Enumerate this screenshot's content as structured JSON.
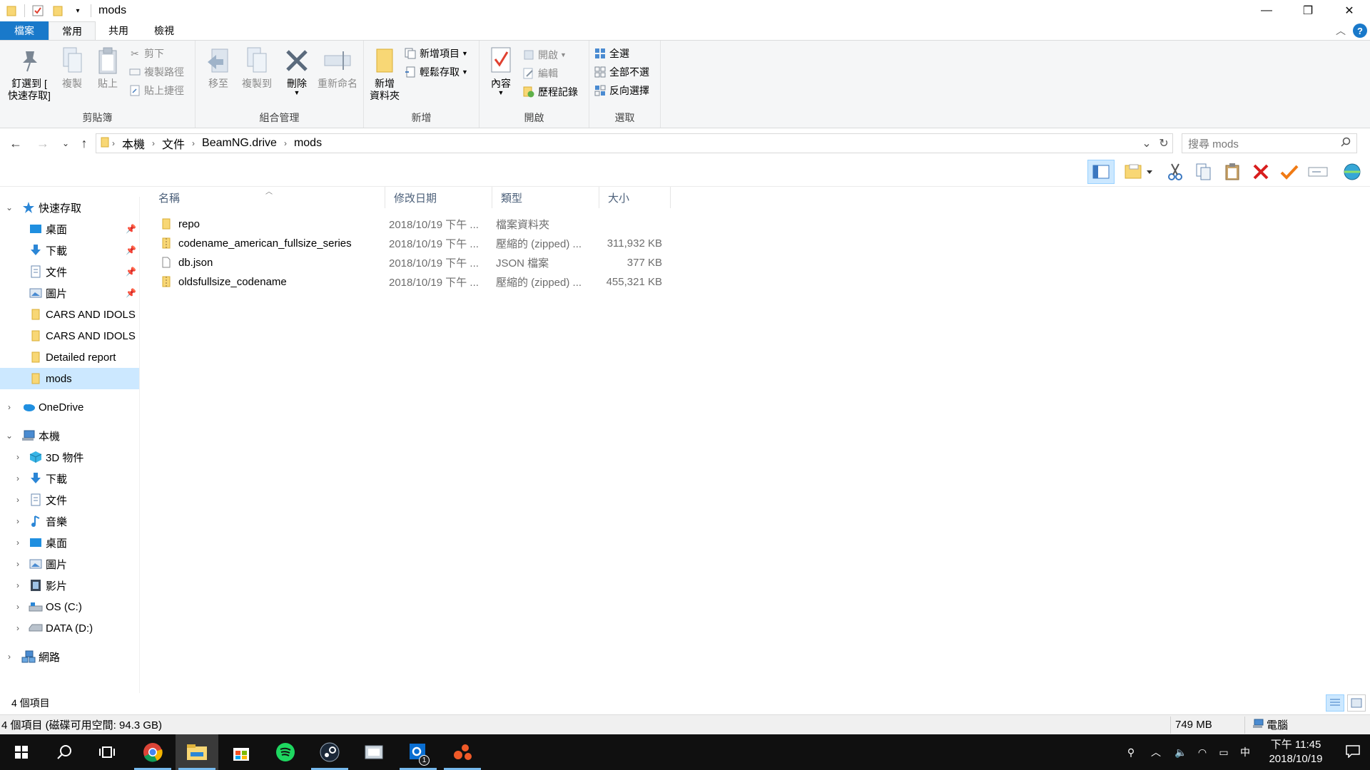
{
  "window": {
    "title": "mods",
    "minimize": "—",
    "restore": "❐",
    "close": "✕"
  },
  "tabs": {
    "file": "檔案",
    "home": "常用",
    "share": "共用",
    "view": "檢視",
    "help": "?"
  },
  "ribbon": {
    "clipboard": {
      "label": "剪貼簿",
      "pin_line1": "釘選到 [",
      "pin_line2": "快速存取]",
      "copy": "複製",
      "paste": "貼上",
      "cut": "剪下",
      "copy_path": "複製路徑",
      "paste_shortcut": "貼上捷徑"
    },
    "organize": {
      "label": "組合管理",
      "move_to": "移至",
      "copy_to": "複製到",
      "delete": "刪除",
      "rename": "重新命名"
    },
    "new": {
      "label": "新增",
      "new_folder_line1": "新增",
      "new_folder_line2": "資料夾",
      "new_item": "新增項目",
      "easy_access": "輕鬆存取"
    },
    "open": {
      "label": "開啟",
      "properties": "內容",
      "open": "開啟",
      "edit": "編輯",
      "history": "歷程記錄"
    },
    "select": {
      "label": "選取",
      "select_all": "全選",
      "select_none": "全部不選",
      "invert": "反向選擇"
    }
  },
  "address": {
    "crumbs": [
      "本機",
      "文件",
      "BeamNG.drive",
      "mods"
    ],
    "search_placeholder": "搜尋 mods"
  },
  "nav": {
    "quick_access": "快速存取",
    "qa_items": [
      {
        "label": "桌面",
        "icon": "desktop-icon",
        "pinned": true
      },
      {
        "label": "下載",
        "icon": "download-icon",
        "pinned": true
      },
      {
        "label": "文件",
        "icon": "document-icon",
        "pinned": true
      },
      {
        "label": "圖片",
        "icon": "pictures-icon",
        "pinned": true
      },
      {
        "label": "CARS AND IDOLS",
        "icon": "folder-icon",
        "pinned": false
      },
      {
        "label": "CARS AND IDOLS",
        "icon": "folder-icon",
        "pinned": false
      },
      {
        "label": "Detailed report",
        "icon": "folder-icon",
        "pinned": false
      },
      {
        "label": "mods",
        "icon": "folder-icon",
        "pinned": false
      }
    ],
    "onedrive": "OneDrive",
    "this_pc": "本機",
    "pc_items": [
      {
        "label": "3D 物件",
        "icon": "3d-objects-icon"
      },
      {
        "label": "下載",
        "icon": "download-icon"
      },
      {
        "label": "文件",
        "icon": "document-icon"
      },
      {
        "label": "音樂",
        "icon": "music-icon"
      },
      {
        "label": "桌面",
        "icon": "desktop-icon"
      },
      {
        "label": "圖片",
        "icon": "pictures-icon"
      },
      {
        "label": "影片",
        "icon": "video-icon"
      },
      {
        "label": "OS (C:)",
        "icon": "os-drive-icon"
      },
      {
        "label": "DATA (D:)",
        "icon": "drive-icon"
      }
    ],
    "network": "網路"
  },
  "columns": {
    "name": "名稱",
    "date": "修改日期",
    "type": "類型",
    "size": "大小"
  },
  "files": [
    {
      "name": "repo",
      "date": "2018/10/19 下午 ...",
      "type": "檔案資料夾",
      "size": "",
      "icon": "folder-icon"
    },
    {
      "name": "codename_american_fullsize_series",
      "date": "2018/10/19 下午 ...",
      "type": "壓縮的 (zipped) ...",
      "size": "311,932 KB",
      "icon": "zip-folder-icon"
    },
    {
      "name": "db.json",
      "date": "2018/10/19 下午 ...",
      "type": "JSON 檔案",
      "size": "377 KB",
      "icon": "file-icon"
    },
    {
      "name": "oldsfullsize_codename",
      "date": "2018/10/19 下午 ...",
      "type": "壓縮的 (zipped) ...",
      "size": "455,321 KB",
      "icon": "zip-folder-icon"
    }
  ],
  "status": {
    "item_count": "4 個項目",
    "detail": "4 個項目 (磁碟可用空間: 94.3 GB)",
    "size": "749 MB",
    "location": "電腦"
  },
  "taskbar": {
    "apps": [
      "start-icon",
      "search-icon",
      "task-view-icon",
      "chrome-icon",
      "file-explorer-icon",
      "store-icon",
      "spotify-icon",
      "steam-icon",
      "app-icon",
      "outlook-icon",
      "app-icon"
    ],
    "outlook_badge": "1",
    "ime": "中",
    "time": "下午 11:45",
    "date": "2018/10/19"
  },
  "colors": {
    "accent": "#1979ca",
    "selection": "#cce8ff",
    "folder": "#f8d775",
    "taskbar": "#101010"
  }
}
